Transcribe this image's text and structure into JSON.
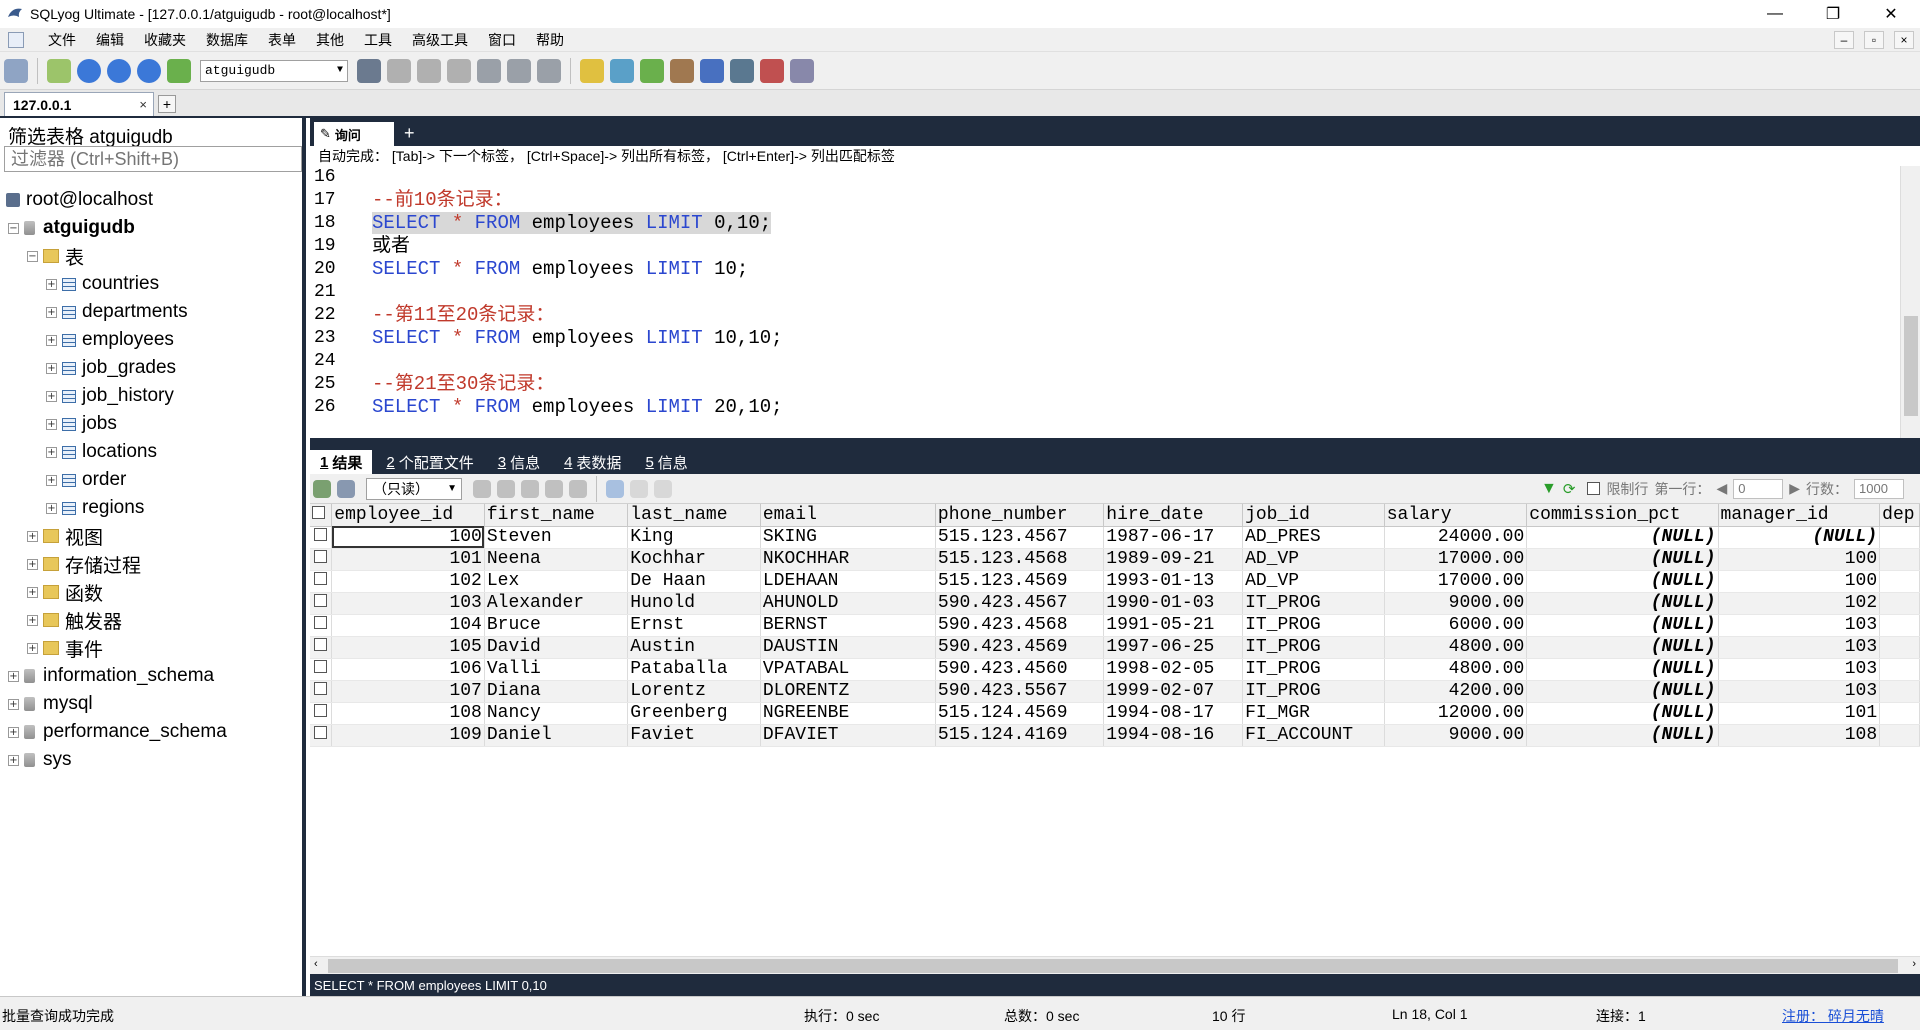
{
  "window": {
    "title": "SQLyog Ultimate - [127.0.0.1/atguigudb - root@localhost*]",
    "controls": {
      "minimize": "—",
      "restore": "❐",
      "close": "✕"
    }
  },
  "menu": {
    "items": [
      "文件",
      "编辑",
      "收藏夹",
      "数据库",
      "表单",
      "其他",
      "工具",
      "高级工具",
      "窗口",
      "帮助"
    ]
  },
  "toolbar": {
    "db_select": "atguigudb"
  },
  "connection_tab": {
    "label": "127.0.0.1",
    "close": "×",
    "add": "+"
  },
  "left_panel": {
    "filter_title": "筛选表格 atguigudb",
    "filter_placeholder": "过滤器 (Ctrl+Shift+B)",
    "tree": {
      "root": "root@localhost",
      "current_db": "atguigudb",
      "tables_folder": "表",
      "tables": [
        "countries",
        "departments",
        "employees",
        "job_grades",
        "job_history",
        "jobs",
        "locations",
        "order",
        "regions"
      ],
      "other_folders": [
        "视图",
        "存储过程",
        "函数",
        "触发器",
        "事件"
      ],
      "other_dbs": [
        "information_schema",
        "mysql",
        "performance_schema",
        "sys"
      ]
    }
  },
  "query": {
    "tab_label": "询问",
    "add": "+",
    "hint": "自动完成： [Tab]-> 下一个标签， [Ctrl+Space]-> 列出所有标签， [Ctrl+Enter]-> 列出匹配标签",
    "line_numbers": [
      "16",
      "17",
      "18",
      "19",
      "20",
      "21",
      "22",
      "23",
      "24",
      "25",
      "26"
    ],
    "lines": {
      "l17": "--前10条记录：",
      "l19": "或者",
      "l22": "--第11至20条记录：",
      "l25": "--第21至30条记录：",
      "kw_select": "SELECT",
      "kw_star": "*",
      "kw_from": "FROM",
      "kw_limit": "LIMIT",
      "table": "employees",
      "l18_tail": "0,10;",
      "l20_tail": "10;",
      "l23_tail": "10,10;",
      "l26_tail": "20,10;"
    }
  },
  "result_tabs": [
    {
      "num": "1",
      "label": "结果"
    },
    {
      "num": "2",
      "label": "个配置文件"
    },
    {
      "num": "3",
      "label": "信息"
    },
    {
      "num": "4",
      "label": "表数据"
    },
    {
      "num": "5",
      "label": "信息"
    }
  ],
  "result_toolbar": {
    "mode": "（只读）",
    "limit_label": "限制行",
    "first_row_label": "第一行：",
    "first_row_value": "0",
    "rows_label": "行数：",
    "rows_value": "1000"
  },
  "grid": {
    "columns": [
      "employee_id",
      "first_name",
      "last_name",
      "email",
      "phone_number",
      "hire_date",
      "job_id",
      "salary",
      "commission_pct",
      "manager_id",
      "dep"
    ],
    "rows": [
      [
        "100",
        "Steven",
        "King",
        "SKING",
        "515.123.4567",
        "1987-06-17",
        "AD_PRES",
        "24000.00",
        "(NULL)",
        "(NULL)"
      ],
      [
        "101",
        "Neena",
        "Kochhar",
        "NKOCHHAR",
        "515.123.4568",
        "1989-09-21",
        "AD_VP",
        "17000.00",
        "(NULL)",
        "100"
      ],
      [
        "102",
        "Lex",
        "De Haan",
        "LDEHAAN",
        "515.123.4569",
        "1993-01-13",
        "AD_VP",
        "17000.00",
        "(NULL)",
        "100"
      ],
      [
        "103",
        "Alexander",
        "Hunold",
        "AHUNOLD",
        "590.423.4567",
        "1990-01-03",
        "IT_PROG",
        "9000.00",
        "(NULL)",
        "102"
      ],
      [
        "104",
        "Bruce",
        "Ernst",
        "BERNST",
        "590.423.4568",
        "1991-05-21",
        "IT_PROG",
        "6000.00",
        "(NULL)",
        "103"
      ],
      [
        "105",
        "David",
        "Austin",
        "DAUSTIN",
        "590.423.4569",
        "1997-06-25",
        "IT_PROG",
        "4800.00",
        "(NULL)",
        "103"
      ],
      [
        "106",
        "Valli",
        "Pataballa",
        "VPATABAL",
        "590.423.4560",
        "1998-02-05",
        "IT_PROG",
        "4800.00",
        "(NULL)",
        "103"
      ],
      [
        "107",
        "Diana",
        "Lorentz",
        "DLORENTZ",
        "590.423.5567",
        "1999-02-07",
        "IT_PROG",
        "4200.00",
        "(NULL)",
        "103"
      ],
      [
        "108",
        "Nancy",
        "Greenberg",
        "NGREENBE",
        "515.124.4569",
        "1994-08-17",
        "FI_MGR",
        "12000.00",
        "(NULL)",
        "101"
      ],
      [
        "109",
        "Daniel",
        "Faviet",
        "DFAVIET",
        "515.124.4169",
        "1994-08-16",
        "FI_ACCOUNT",
        "9000.00",
        "(NULL)",
        "108"
      ]
    ]
  },
  "sql_footer": "SELECT * FROM employees LIMIT 0,10",
  "status": {
    "message": "批量查询成功完成",
    "exec": "执行：0 sec",
    "total": "总数：0 sec",
    "rows": "10 行",
    "cursor": "Ln 18, Col 1",
    "connection": "连接：1",
    "register": "注册： 碎月无晴"
  }
}
